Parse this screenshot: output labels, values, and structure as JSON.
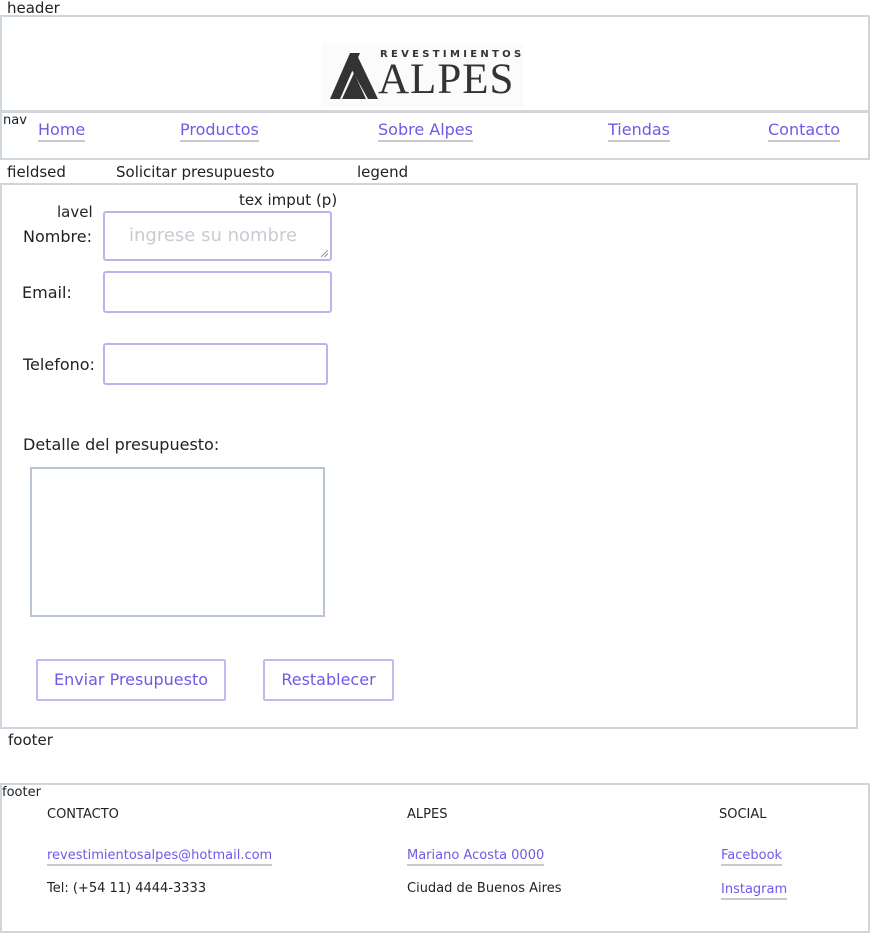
{
  "annotations": {
    "header": "header",
    "nav": "nav",
    "fieldset": "fieldsed",
    "legend_text": "Solicitar presupuesto",
    "legend": "legend",
    "text_input": "tex imput (p)",
    "label": "lavel",
    "footer_outside": "footer",
    "footer_inside": "footer"
  },
  "header": {
    "logo": {
      "small": "REVESTIMIENTOS",
      "big": "ALPES"
    }
  },
  "nav": {
    "items": [
      {
        "label": "Home"
      },
      {
        "label": "Productos"
      },
      {
        "label": "Sobre Alpes"
      },
      {
        "label": "Tiendas"
      },
      {
        "label": "Contacto"
      }
    ]
  },
  "form": {
    "name_label": "Nombre:",
    "name_placeholder": "ingrese su nombre",
    "email_label": "Email:",
    "phone_label": "Telefono:",
    "detail_label": "Detalle del presupuesto:",
    "submit_label": "Enviar Presupuesto",
    "reset_label": "Restablecer"
  },
  "footer": {
    "contact": {
      "heading": "CONTACTO",
      "email": "revestimientosalpes@hotmail.com",
      "phone": "Tel: (+54 11) 4444-3333"
    },
    "alpes": {
      "heading": "ALPES",
      "address": "Mariano Acosta 0000",
      "city": "Ciudad de Buenos Aires"
    },
    "social": {
      "heading": "SOCIAL",
      "facebook": "Facebook",
      "instagram": "Instagram"
    }
  },
  "colors": {
    "link": "#6e5ae6",
    "border": "#cfd6de",
    "input_border": "#bcb3ee",
    "placeholder": "#c5ccd3"
  }
}
